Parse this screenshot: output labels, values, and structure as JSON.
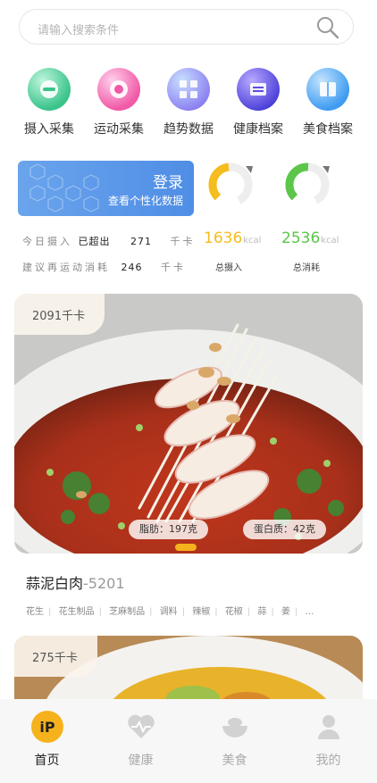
{
  "search": {
    "placeholder": "请输入搜索条件",
    "icon": "search-icon"
  },
  "categories": [
    {
      "label": "摄入采集",
      "icon": "intake-icon",
      "color": "#3ac48a"
    },
    {
      "label": "运动采集",
      "icon": "exercise-icon",
      "color": "#f05aa6"
    },
    {
      "label": "趋势数据",
      "icon": "trend-icon",
      "color": "#6b8ff0"
    },
    {
      "label": "健康档案",
      "icon": "health-record-icon",
      "color": "#5a4fe0"
    },
    {
      "label": "美食档案",
      "icon": "food-record-icon",
      "color": "#3f9cf0"
    }
  ],
  "login": {
    "title": "登录",
    "subtitle": "查看个性化数据"
  },
  "intake": {
    "value": "1636",
    "unit": "kcal",
    "label": "总摄入",
    "color": "#f5bd1d"
  },
  "burn": {
    "value": "2536",
    "unit": "kcal",
    "label": "总消耗",
    "color": "#5cc64a"
  },
  "stats": {
    "today_prefix": "今日摄入",
    "today_status": "已超出",
    "today_value": "271",
    "today_unit": "千卡",
    "suggest_prefix": "建议再运动消耗",
    "suggest_value": "246",
    "suggest_unit": "千卡"
  },
  "food_cards": [
    {
      "calories": "2091千卡",
      "fat": "脂肪：197克",
      "protein": "蛋白质：42克",
      "name": "蒜泥白肉",
      "id": "-5201",
      "ingredients": [
        "花生",
        "花生制品",
        "芝麻制品",
        "调料",
        "辣椒",
        "花椒",
        "蒜",
        "姜",
        "…"
      ]
    },
    {
      "calories": "275千卡"
    }
  ],
  "tabs": [
    {
      "label": "首页",
      "icon": "home-icon",
      "active": true
    },
    {
      "label": "健康",
      "icon": "heart-icon",
      "active": false
    },
    {
      "label": "美食",
      "icon": "food-bowl-icon",
      "active": false
    },
    {
      "label": "我的",
      "icon": "profile-icon",
      "active": false
    }
  ],
  "colors": {
    "accent": "#f5b21c",
    "login_blue": "#5a96e8"
  }
}
